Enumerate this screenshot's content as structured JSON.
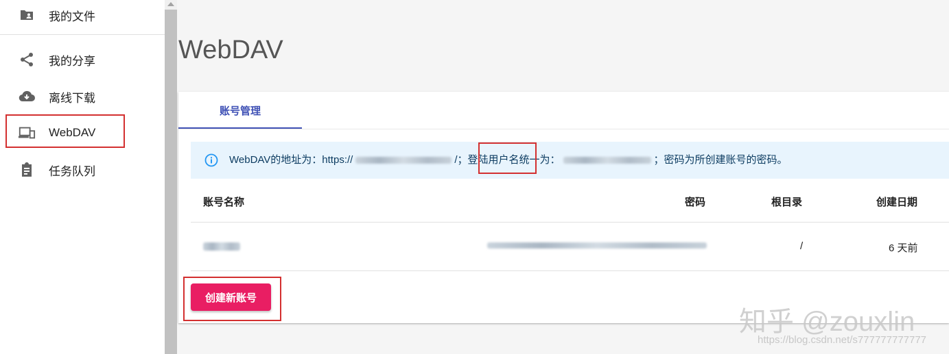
{
  "sidebar": {
    "items": [
      {
        "label": "我的文件",
        "icon": "folder-account-icon"
      },
      {
        "label": "我的分享",
        "icon": "share-icon"
      },
      {
        "label": "离线下载",
        "icon": "cloud-download-icon"
      },
      {
        "label": "WebDAV",
        "icon": "devices-icon"
      },
      {
        "label": "任务队列",
        "icon": "clipboard-icon"
      }
    ]
  },
  "page": {
    "title": "WebDAV"
  },
  "tabs": [
    {
      "label": "账号管理"
    }
  ],
  "alert": {
    "prefix": "WebDAV的地址为：https://",
    "slash": "/；",
    "highlight": "登陆用户名",
    "middle": "统一为：",
    "suffix": "；密码为所创建账号的密码。"
  },
  "table": {
    "headers": [
      "账号名称",
      "密码",
      "根目录",
      "创建日期"
    ],
    "rows": [
      {
        "root": "/",
        "created": "6 天前"
      }
    ]
  },
  "buttons": {
    "create": "创建新账号"
  },
  "watermark": {
    "line1": "知乎 @zouxlin",
    "line2": "https://blog.csdn.net/s777777777777"
  },
  "colors": {
    "accent": "#3f51b5",
    "primary_button": "#e91e63",
    "highlight_box": "#d32f2f",
    "alert_bg": "#e8f4fd"
  }
}
